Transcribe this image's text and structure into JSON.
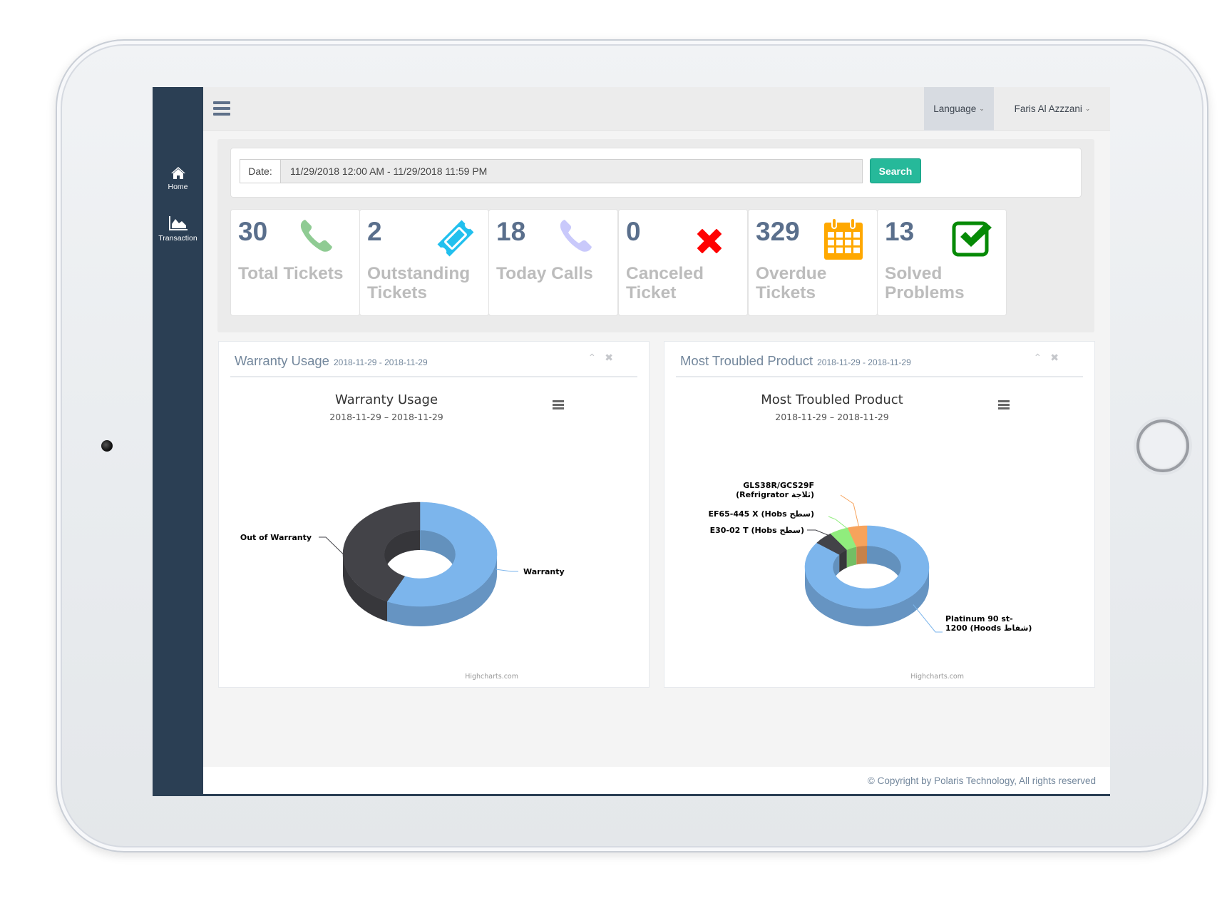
{
  "topbar": {
    "menu_icon": "hamburger-icon",
    "language_label": "Language",
    "user_name": "Faris Al Azzzani",
    "caret_icon": "chevron-down-icon"
  },
  "sidebar": {
    "items": [
      {
        "label": "Home",
        "icon": "home-icon"
      },
      {
        "label": "Transaction",
        "icon": "area-chart-icon"
      }
    ]
  },
  "filter": {
    "date_label": "Date:",
    "date_range_value": "11/29/2018 12:00 AM - 11/29/2018 11:59 PM",
    "search_label": "Search"
  },
  "stats": [
    {
      "value": "30",
      "label": "Total Tickets",
      "icon": "phone-icon",
      "color": "#8fcb93"
    },
    {
      "value": "2",
      "label": "Outstanding Tickets",
      "icon": "ticket-icon",
      "color": "#22c0ee"
    },
    {
      "value": "18",
      "label": "Today Calls",
      "icon": "phone-icon",
      "color": "#c9c9fb"
    },
    {
      "value": "0",
      "label": "Canceled Ticket",
      "icon": "close-icon",
      "color": "#ff0000"
    },
    {
      "value": "329",
      "label": "Overdue Tickets",
      "icon": "calendar-icon",
      "color": "#ffa800"
    },
    {
      "value": "13",
      "label": "Solved Problems",
      "icon": "check-square-icon",
      "color": "#068a06"
    }
  ],
  "panels": [
    {
      "title": "Warranty Usage",
      "date_range": "2018-11-29 - 2018-11-29",
      "collapse_icon": "chevron-up-icon",
      "close_icon": "close-icon"
    },
    {
      "title": "Most Troubled Product",
      "date_range": "2018-11-29 - 2018-11-29",
      "collapse_icon": "chevron-up-icon",
      "close_icon": "close-icon"
    }
  ],
  "chart_data": [
    {
      "type": "pie",
      "variant": "3d-donut",
      "title": "Warranty Usage",
      "subtitle": "2018-11-29 – 2018-11-29",
      "categories": [
        "Warranty",
        "Out of Warranty"
      ],
      "values": [
        57,
        43
      ],
      "colors": [
        "#7cb5ec",
        "#434348"
      ],
      "menu_icon": "hamburger-icon",
      "credit": "Highcharts.com"
    },
    {
      "type": "pie",
      "variant": "3d-donut",
      "title": "Most Troubled Product",
      "subtitle": "2018-11-29 – 2018-11-29",
      "categories": [
        "Platinum 90 st-1200 (Hoods شفاط)",
        "E30-02 T (Hobs سطح)",
        "EF65-445 X (Hobs سطح)",
        "GLS38R/GCS29F (Refrigrator ثلاجة)"
      ],
      "label_lines": [
        [
          "Platinum 90 st-",
          "1200 (Hoods شفاط)"
        ],
        [
          "E30-02 T (Hobs سطح)"
        ],
        [
          "EF65-445 X (Hobs سطح)"
        ],
        [
          "GLS38R/GCS29F",
          "(Refrigrator ثلاجة)"
        ]
      ],
      "values": [
        85,
        5,
        5,
        5
      ],
      "colors": [
        "#7cb5ec",
        "#434348",
        "#90ed7d",
        "#f7a35c"
      ],
      "menu_icon": "hamburger-icon",
      "credit": "Highcharts.com"
    }
  ],
  "footer": {
    "copyright": "© Copyright by Polaris Technology, All rights reserved"
  }
}
